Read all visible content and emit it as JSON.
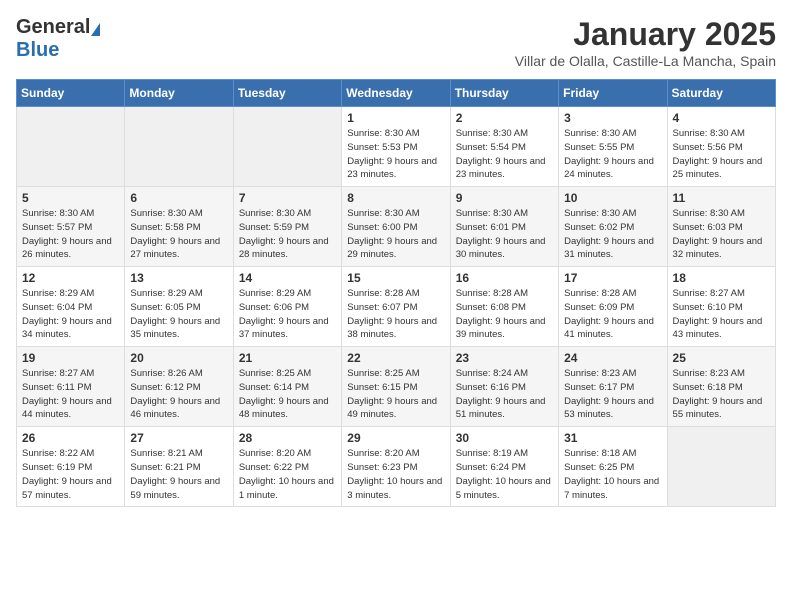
{
  "header": {
    "logo_general": "General",
    "logo_blue": "Blue",
    "title": "January 2025",
    "location": "Villar de Olalla, Castille-La Mancha, Spain"
  },
  "calendar": {
    "days_of_week": [
      "Sunday",
      "Monday",
      "Tuesday",
      "Wednesday",
      "Thursday",
      "Friday",
      "Saturday"
    ],
    "weeks": [
      [
        {
          "day": "",
          "info": ""
        },
        {
          "day": "",
          "info": ""
        },
        {
          "day": "",
          "info": ""
        },
        {
          "day": "1",
          "info": "Sunrise: 8:30 AM\nSunset: 5:53 PM\nDaylight: 9 hours\nand 23 minutes."
        },
        {
          "day": "2",
          "info": "Sunrise: 8:30 AM\nSunset: 5:54 PM\nDaylight: 9 hours\nand 23 minutes."
        },
        {
          "day": "3",
          "info": "Sunrise: 8:30 AM\nSunset: 5:55 PM\nDaylight: 9 hours\nand 24 minutes."
        },
        {
          "day": "4",
          "info": "Sunrise: 8:30 AM\nSunset: 5:56 PM\nDaylight: 9 hours\nand 25 minutes."
        }
      ],
      [
        {
          "day": "5",
          "info": "Sunrise: 8:30 AM\nSunset: 5:57 PM\nDaylight: 9 hours\nand 26 minutes."
        },
        {
          "day": "6",
          "info": "Sunrise: 8:30 AM\nSunset: 5:58 PM\nDaylight: 9 hours\nand 27 minutes."
        },
        {
          "day": "7",
          "info": "Sunrise: 8:30 AM\nSunset: 5:59 PM\nDaylight: 9 hours\nand 28 minutes."
        },
        {
          "day": "8",
          "info": "Sunrise: 8:30 AM\nSunset: 6:00 PM\nDaylight: 9 hours\nand 29 minutes."
        },
        {
          "day": "9",
          "info": "Sunrise: 8:30 AM\nSunset: 6:01 PM\nDaylight: 9 hours\nand 30 minutes."
        },
        {
          "day": "10",
          "info": "Sunrise: 8:30 AM\nSunset: 6:02 PM\nDaylight: 9 hours\nand 31 minutes."
        },
        {
          "day": "11",
          "info": "Sunrise: 8:30 AM\nSunset: 6:03 PM\nDaylight: 9 hours\nand 32 minutes."
        }
      ],
      [
        {
          "day": "12",
          "info": "Sunrise: 8:29 AM\nSunset: 6:04 PM\nDaylight: 9 hours\nand 34 minutes."
        },
        {
          "day": "13",
          "info": "Sunrise: 8:29 AM\nSunset: 6:05 PM\nDaylight: 9 hours\nand 35 minutes."
        },
        {
          "day": "14",
          "info": "Sunrise: 8:29 AM\nSunset: 6:06 PM\nDaylight: 9 hours\nand 37 minutes."
        },
        {
          "day": "15",
          "info": "Sunrise: 8:28 AM\nSunset: 6:07 PM\nDaylight: 9 hours\nand 38 minutes."
        },
        {
          "day": "16",
          "info": "Sunrise: 8:28 AM\nSunset: 6:08 PM\nDaylight: 9 hours\nand 39 minutes."
        },
        {
          "day": "17",
          "info": "Sunrise: 8:28 AM\nSunset: 6:09 PM\nDaylight: 9 hours\nand 41 minutes."
        },
        {
          "day": "18",
          "info": "Sunrise: 8:27 AM\nSunset: 6:10 PM\nDaylight: 9 hours\nand 43 minutes."
        }
      ],
      [
        {
          "day": "19",
          "info": "Sunrise: 8:27 AM\nSunset: 6:11 PM\nDaylight: 9 hours\nand 44 minutes."
        },
        {
          "day": "20",
          "info": "Sunrise: 8:26 AM\nSunset: 6:12 PM\nDaylight: 9 hours\nand 46 minutes."
        },
        {
          "day": "21",
          "info": "Sunrise: 8:25 AM\nSunset: 6:14 PM\nDaylight: 9 hours\nand 48 minutes."
        },
        {
          "day": "22",
          "info": "Sunrise: 8:25 AM\nSunset: 6:15 PM\nDaylight: 9 hours\nand 49 minutes."
        },
        {
          "day": "23",
          "info": "Sunrise: 8:24 AM\nSunset: 6:16 PM\nDaylight: 9 hours\nand 51 minutes."
        },
        {
          "day": "24",
          "info": "Sunrise: 8:23 AM\nSunset: 6:17 PM\nDaylight: 9 hours\nand 53 minutes."
        },
        {
          "day": "25",
          "info": "Sunrise: 8:23 AM\nSunset: 6:18 PM\nDaylight: 9 hours\nand 55 minutes."
        }
      ],
      [
        {
          "day": "26",
          "info": "Sunrise: 8:22 AM\nSunset: 6:19 PM\nDaylight: 9 hours\nand 57 minutes."
        },
        {
          "day": "27",
          "info": "Sunrise: 8:21 AM\nSunset: 6:21 PM\nDaylight: 9 hours\nand 59 minutes."
        },
        {
          "day": "28",
          "info": "Sunrise: 8:20 AM\nSunset: 6:22 PM\nDaylight: 10 hours\nand 1 minute."
        },
        {
          "day": "29",
          "info": "Sunrise: 8:20 AM\nSunset: 6:23 PM\nDaylight: 10 hours\nand 3 minutes."
        },
        {
          "day": "30",
          "info": "Sunrise: 8:19 AM\nSunset: 6:24 PM\nDaylight: 10 hours\nand 5 minutes."
        },
        {
          "day": "31",
          "info": "Sunrise: 8:18 AM\nSunset: 6:25 PM\nDaylight: 10 hours\nand 7 minutes."
        },
        {
          "day": "",
          "info": ""
        }
      ]
    ]
  }
}
